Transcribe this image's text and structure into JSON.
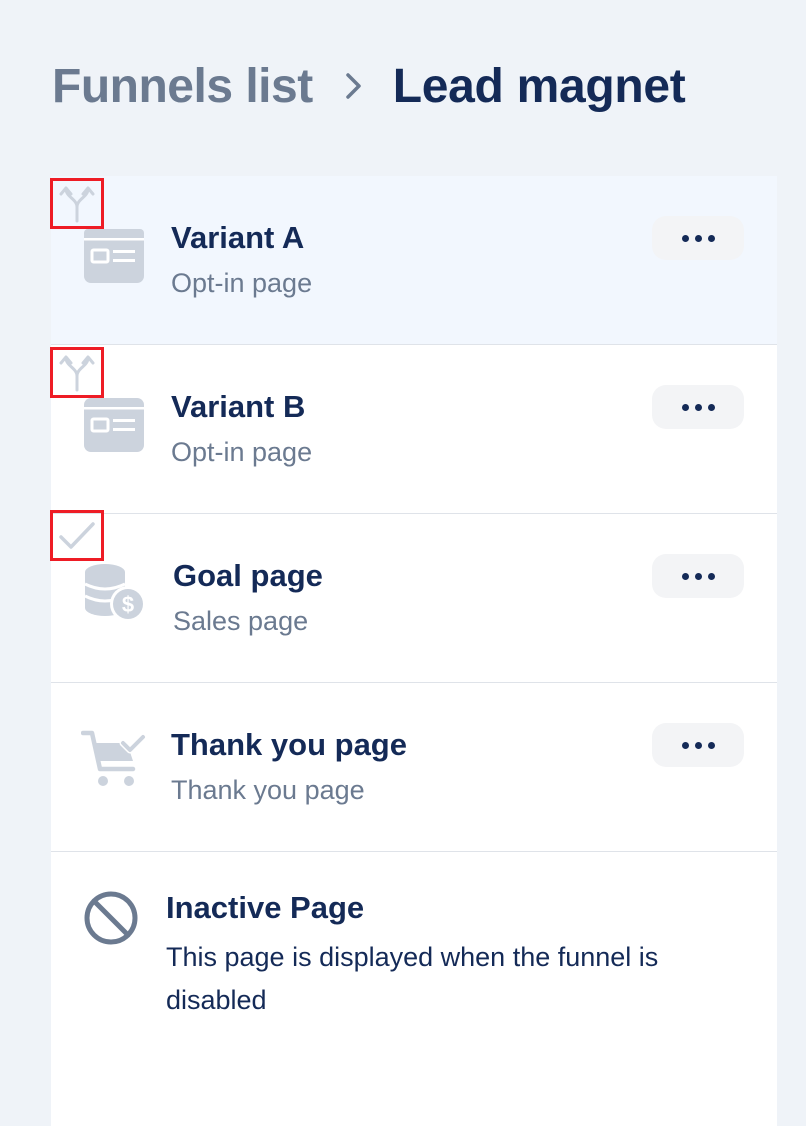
{
  "breadcrumb": {
    "parent": "Funnels list",
    "current": "Lead magnet"
  },
  "rows": [
    {
      "title": "Variant A",
      "subtitle": "Opt-in page",
      "type_icon": "page-layout-icon",
      "badge_icon": "split-arrow-icon",
      "highlighted": true
    },
    {
      "title": "Variant B",
      "subtitle": "Opt-in page",
      "type_icon": "page-layout-icon",
      "badge_icon": "split-arrow-icon",
      "highlighted": false
    },
    {
      "title": "Goal page",
      "subtitle": "Sales page",
      "type_icon": "coins-dollar-icon",
      "badge_icon": "checkmark-icon",
      "highlighted": false
    },
    {
      "title": "Thank you page",
      "subtitle": "Thank you page",
      "type_icon": "cart-check-icon",
      "badge_icon": null,
      "highlighted": false
    }
  ],
  "inactive": {
    "title": "Inactive Page",
    "description": "This page is displayed when the funnel is disabled",
    "icon": "ban-icon"
  },
  "colors": {
    "background": "#eff3f8",
    "title": "#142a57",
    "muted": "#6b7a90",
    "highlight_row": "#f2f7fe",
    "icon_gray": "#ccd3dd",
    "badge_border": "#ee1c25"
  }
}
